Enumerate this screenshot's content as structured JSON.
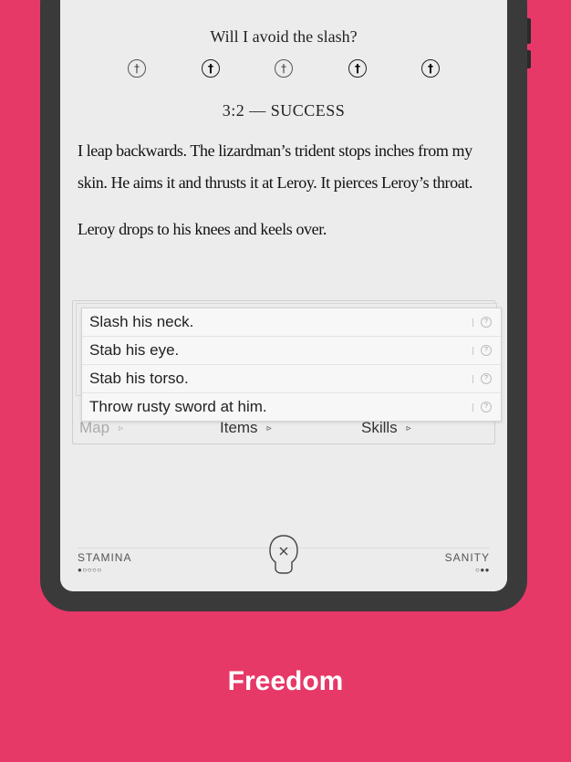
{
  "scene": {
    "question": "Will I avoid the slash?",
    "dice": [
      {
        "glyph": "†",
        "style": "light"
      },
      {
        "glyph": "†",
        "style": "dark"
      },
      {
        "glyph": "†",
        "style": "light"
      },
      {
        "glyph": "†",
        "style": "dark"
      },
      {
        "glyph": "†",
        "style": "dark"
      }
    ],
    "result": "3:2 — SUCCESS",
    "paragraphs": [
      "I leap backwards. The lizardman’s trident stops inches from my skin. He aims it and thrusts it at Leroy. It pierces Leroy’s throat.",
      "Leroy drops to his knees and keels over."
    ]
  },
  "choices": [
    {
      "label": "Slash his neck.",
      "icon": "dice-icon"
    },
    {
      "label": "Stab his eye.",
      "icon": "dice-icon"
    },
    {
      "label": "Stab his torso.",
      "icon": "dice-icon"
    },
    {
      "label": "Throw rusty sword at him.",
      "icon": "dice-icon"
    }
  ],
  "nav": {
    "map_label": "Map",
    "items_label": "Items",
    "skills_label": "Skills",
    "arrow": "▹"
  },
  "status": {
    "stamina_label": "STAMINA",
    "stamina_pips": "●○○○○",
    "sanity_label": "SANITY",
    "sanity_pips": "○●●",
    "center_icon": "skull-close-icon"
  },
  "caption": "Freedom",
  "colors": {
    "background": "#e63968",
    "device": "#3a3a3a",
    "screen": "#ececec"
  }
}
